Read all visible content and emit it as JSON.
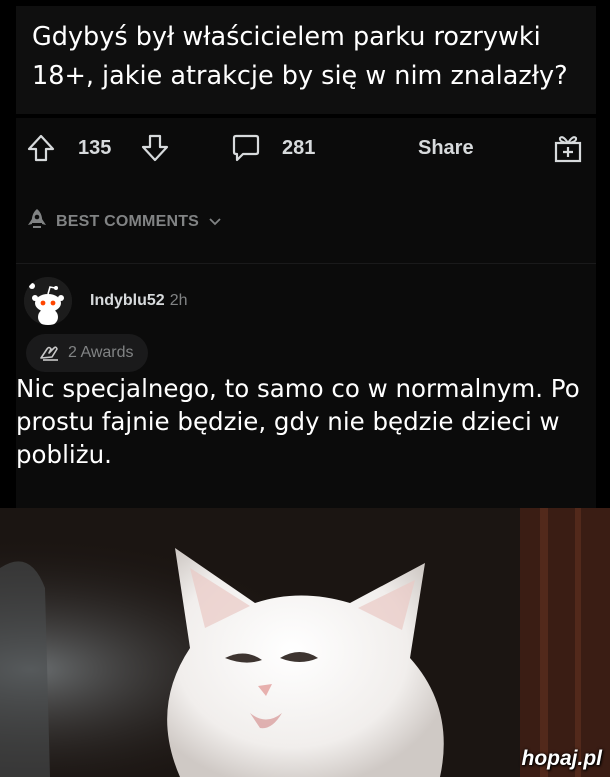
{
  "post": {
    "title": "Gdybyś był właścicielem parku rozrywki 18+, jakie atrakcje by się w nim znalazły?"
  },
  "actions": {
    "upvote_count": "135",
    "comment_count": "281",
    "share_label": "Share"
  },
  "comments_section": {
    "sort_label": "BEST COMMENTS"
  },
  "comment": {
    "username": "Indyblu52",
    "time": "2h",
    "awards_label": "2 Awards",
    "body": "Nic specjalnego, to samo co w normalnym. Po prostu fajnie będzie, gdy nie będzie dzieci w pobliżu."
  },
  "watermark": {
    "text": "hopaj.pl"
  },
  "icons": {
    "upvote": "arrow-up-icon",
    "downvote": "arrow-down-icon",
    "comments": "speech-bubble-icon",
    "gift": "gift-icon",
    "rocket": "rocket-icon",
    "chevron": "chevron-down-icon",
    "awards": "award-hands-icon",
    "avatar": "reddit-snoo-icon"
  },
  "colors": {
    "background": "#000000",
    "panel": "#0b0b0b",
    "text_primary": "#d7dadc",
    "text_muted": "#818384"
  }
}
